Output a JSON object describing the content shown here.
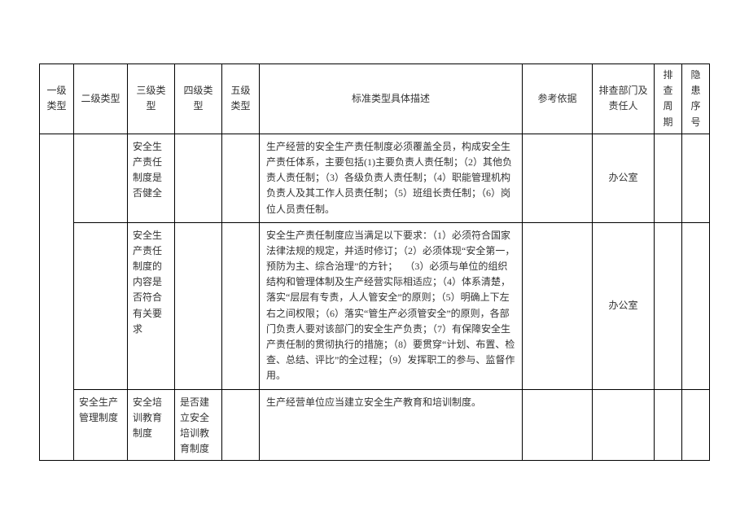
{
  "headers": {
    "c1": "一级类型",
    "c2": "二级类型",
    "c3": "三级类型",
    "c4": "四级类型",
    "c5": "五级类型",
    "c6": "标准类型具体描述",
    "c7": "参考依据",
    "c8": "排查部门及责任人",
    "c9": "排查周期",
    "c10": "隐患序号"
  },
  "rows": {
    "r1": {
      "lv3": "安全生产责任制度是否健全",
      "desc": "生产经营的安全生产责任制度必须覆盖全员，构成安全生产责任体系，主要包括(1)主要负责人责任制；（2）其他负责人责任制；（3）各级负责人责任制；（4）职能管理机构负责人及其工作人员责任制；（5）班组长责任制；（6）岗位人员责任制。",
      "dept": "办公室"
    },
    "r2": {
      "lv3": "安全生产责任制度的内容是否符合有关要求",
      "desc": "安全生产责任制度应当满足以下要求：（1）必须符合国家法律法规的规定，并适时修订；（2）必须体现“安全第一，预防为主、综合治理”的方针；\n　（3）必须与单位的组织结构和管理体制及生产经营实际相适应；（4）体系清楚，落实“层层有专责，人人管安全”的原则；（5）明确上下左右之间权限；（6）落实“管生产必须管安全”的原则，各部门负责人要对该部门的安全生产负责；（7）有保障安全生产责任制的贯彻执行的措施；（8）要贯穿“计划、布置、检查、总结、评比”的全过程；（9）发挥职工的参与、监督作用。",
      "dept": "办公室"
    },
    "r3": {
      "lv2": "安全生产管理制度",
      "lv3": "安全培训教育制度",
      "lv4": "是否建立安全培训教育制度",
      "desc": "生产经营单位应当建立安全生产教育和培训制度。"
    }
  }
}
